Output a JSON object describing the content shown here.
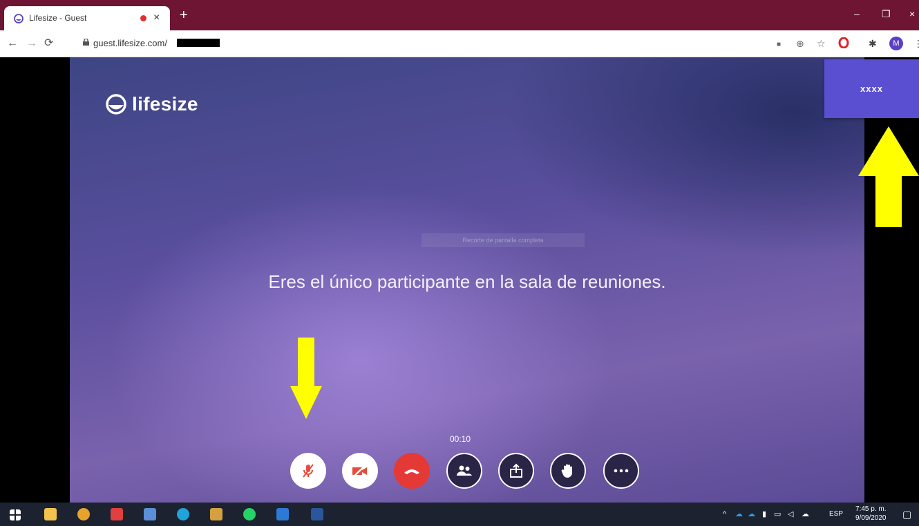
{
  "browser": {
    "tab_title": "Lifesize - Guest",
    "tab_close": "×",
    "new_tab": "+",
    "url": "guest.lifesize.com/",
    "profile_initial": "M",
    "window_controls": [
      "–",
      "❐",
      "×"
    ]
  },
  "meeting": {
    "logo_text": "lifesize",
    "fullscreen_hint": "Recorte de pantalla completa",
    "message": "Eres el único participante en la sala de reuniones.",
    "timer": "00:10",
    "participant_name": "xxxx",
    "controls": [
      "microphone-muted",
      "camera-off",
      "hang-up",
      "participants",
      "share-screen",
      "raise-hand",
      "more-options"
    ],
    "colors": {
      "hangup": "#e53935",
      "name_button": "#5a4fd0",
      "annotation_arrow": "#ffff00"
    }
  },
  "taskbar": {
    "language": "ESP",
    "time": "7:45 p. m.",
    "date": "9/09/2020"
  }
}
